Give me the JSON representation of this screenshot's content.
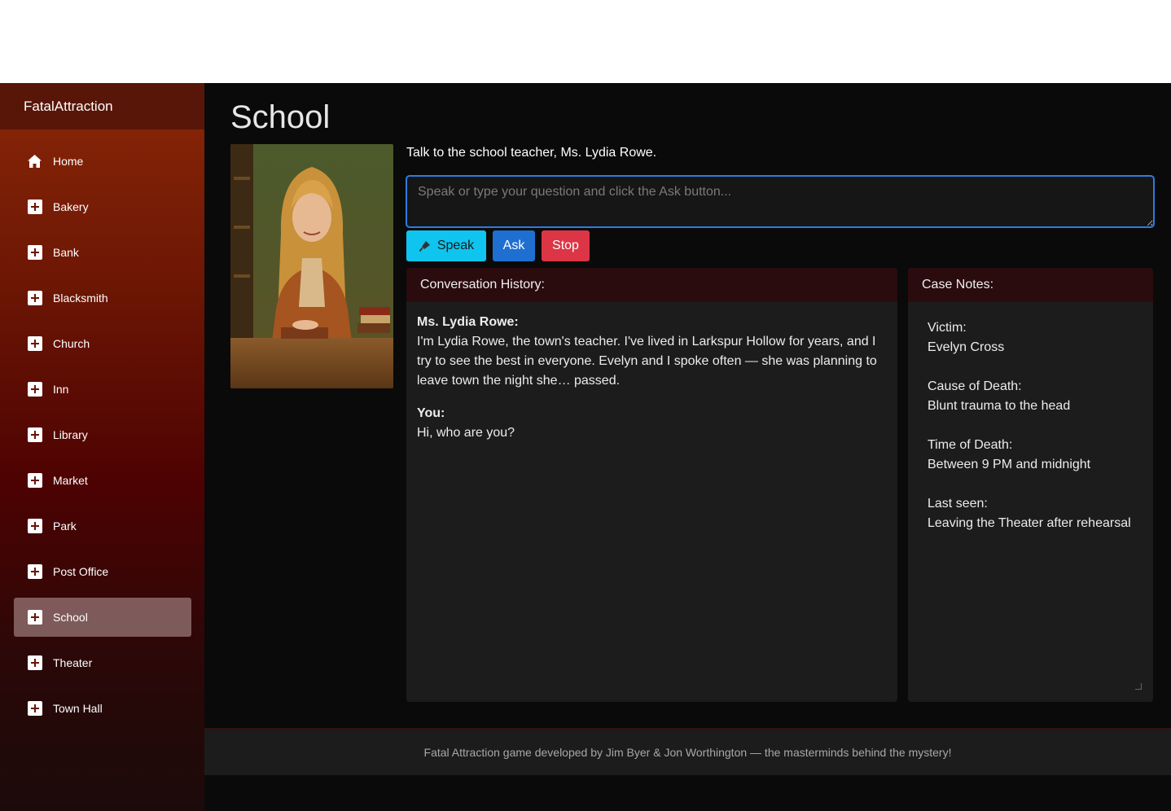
{
  "app": {
    "brand": "FatalAttraction"
  },
  "sidebar": {
    "items": [
      {
        "label": "Home",
        "icon": "home-icon"
      },
      {
        "label": "Bakery",
        "icon": "plus-square-icon"
      },
      {
        "label": "Bank",
        "icon": "plus-square-icon"
      },
      {
        "label": "Blacksmith",
        "icon": "plus-square-icon"
      },
      {
        "label": "Church",
        "icon": "plus-square-icon"
      },
      {
        "label": "Inn",
        "icon": "plus-square-icon"
      },
      {
        "label": "Library",
        "icon": "plus-square-icon"
      },
      {
        "label": "Market",
        "icon": "plus-square-icon"
      },
      {
        "label": "Park",
        "icon": "plus-square-icon"
      },
      {
        "label": "Post Office",
        "icon": "plus-square-icon"
      },
      {
        "label": "School",
        "icon": "plus-square-icon",
        "active": true
      },
      {
        "label": "Theater",
        "icon": "plus-square-icon"
      },
      {
        "label": "Town Hall",
        "icon": "plus-square-icon"
      }
    ]
  },
  "main": {
    "title": "School",
    "intro": "Talk to the school teacher, Ms. Lydia Rowe.",
    "question_placeholder": "Speak or type your question and click the Ask button...",
    "question_value": "",
    "buttons": {
      "speak": "Speak",
      "speak_icon": "microphone-icon",
      "ask": "Ask",
      "stop": "Stop"
    },
    "conversation": {
      "heading": "Conversation History:",
      "messages": [
        {
          "speaker": "Ms. Lydia Rowe:",
          "text": "I'm Lydia Rowe, the town's teacher. I've lived in Larkspur Hollow for years, and I try to see the best in everyone. Evelyn and I spoke often — she was planning to leave town the night she… passed."
        },
        {
          "speaker": "You:",
          "text": "Hi, who are you?"
        }
      ]
    },
    "case_notes": {
      "heading": "Case Notes:",
      "entries": [
        {
          "label": "Victim:",
          "value": "Evelyn Cross"
        },
        {
          "label": "Cause of Death:",
          "value": "Blunt trauma to the head"
        },
        {
          "label": "Time of Death:",
          "value": "Between 9 PM and midnight"
        },
        {
          "label": "Last seen:",
          "value": "Leaving the Theater after rehearsal"
        }
      ]
    }
  },
  "footer": {
    "text": "Fatal Attraction game developed by Jim Byer & Jon Worthington — the masterminds behind the mystery!"
  },
  "colors": {
    "accent_blue": "#1f6fd0",
    "speak_cyan": "#0fc4ee",
    "stop_red": "#dc3545",
    "sidebar_top": "#8a2708",
    "sidebar_bottom": "#1c0a0a"
  }
}
